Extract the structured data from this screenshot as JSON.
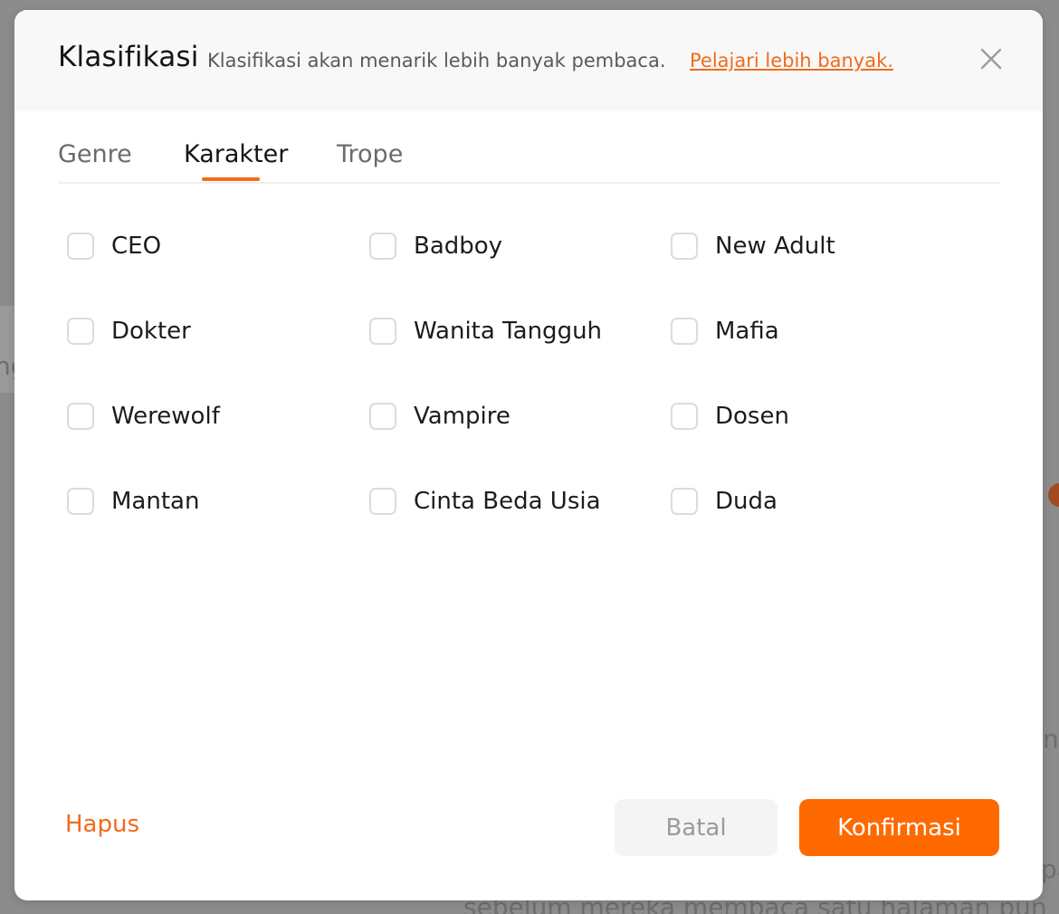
{
  "background": {
    "fragment_1": "ng",
    "fragment_2": "n",
    "fragment_3": "pa",
    "fragment_4": "sebelum mereka membaca satu halaman pun"
  },
  "modal": {
    "title": "Klasifikasi",
    "subtitle": "Klasifikasi akan menarik lebih banyak pembaca.",
    "learn_more": "Pelajari lebih banyak.",
    "close_icon": "close-icon"
  },
  "tabs": [
    {
      "label": "Genre",
      "active": false
    },
    {
      "label": "Karakter",
      "active": true
    },
    {
      "label": "Trope",
      "active": false
    }
  ],
  "options": [
    {
      "label": "CEO",
      "checked": false
    },
    {
      "label": "Badboy",
      "checked": false
    },
    {
      "label": "New Adult",
      "checked": false
    },
    {
      "label": "Dokter",
      "checked": false
    },
    {
      "label": "Wanita Tangguh",
      "checked": false
    },
    {
      "label": "Mafia",
      "checked": false
    },
    {
      "label": "Werewolf",
      "checked": false
    },
    {
      "label": "Vampire",
      "checked": false
    },
    {
      "label": "Dosen",
      "checked": false
    },
    {
      "label": "Mantan",
      "checked": false
    },
    {
      "label": "Cinta Beda Usia",
      "checked": false
    },
    {
      "label": "Duda",
      "checked": false
    }
  ],
  "footer": {
    "clear_label": "Hapus",
    "cancel_label": "Batal",
    "confirm_label": "Konfirmasi"
  },
  "colors": {
    "accent": "#ff6a00",
    "link": "#f26a1b"
  }
}
